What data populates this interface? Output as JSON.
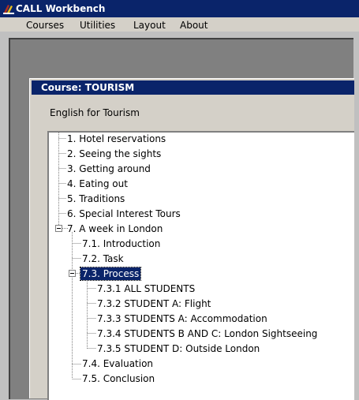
{
  "window": {
    "title": "CALL Workbench"
  },
  "menu": [
    "Courses",
    "Utilities",
    "Layout",
    "About"
  ],
  "course": {
    "title": "Course: TOURISM",
    "description": "English for Tourism"
  },
  "tree": [
    "1. Hotel reservations",
    "2. Seeing the sights",
    "3. Getting around",
    "4. Eating out",
    "5. Traditions",
    "6. Special Interest Tours",
    "7. A week in London",
    "7.1. Introduction",
    "7.2. Task",
    "7.3. Process",
    "7.3.1 ALL STUDENTS",
    "7.3.2 STUDENT A: Flight",
    "7.3.3 STUDENTS A: Accommodation",
    "7.3.4 STUDENTS B AND C: London Sightseeing",
    "7.3.5 STUDENT D: Outside London",
    "7.4. Evaluation",
    "7.5. Conclusion"
  ],
  "selected": "7.3. Process",
  "colors": {
    "title_bar": "#0a246a",
    "menu_bar": "#d4d0c8",
    "client_area": "#808080"
  }
}
